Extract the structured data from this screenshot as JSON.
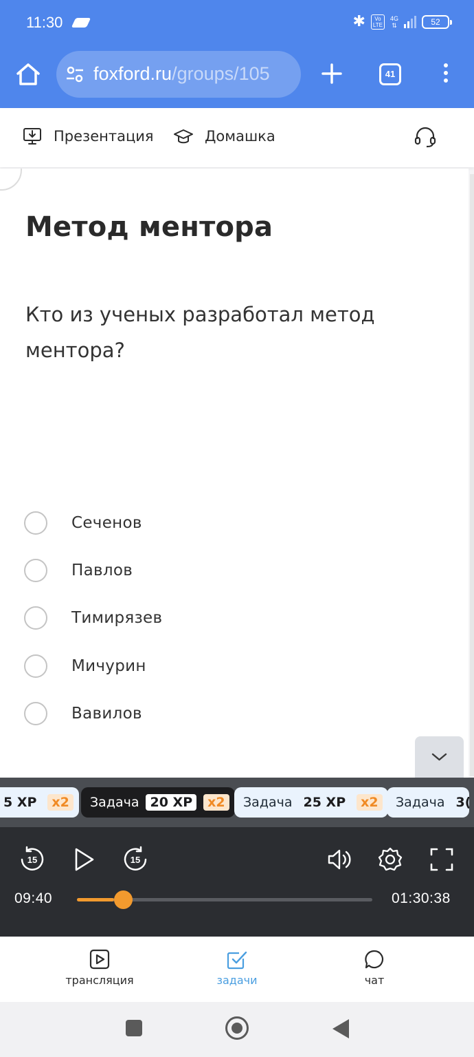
{
  "status_bar": {
    "time": "11:30",
    "volte": "Vo\nLTE",
    "network": "4G",
    "battery": "52"
  },
  "browser": {
    "url_host": "foxford.ru",
    "url_path": "/groups/105",
    "tab_count": "41"
  },
  "toolbar": {
    "presentation_label": "Презентация",
    "homework_label": "Домашка"
  },
  "task": {
    "title": "Метод ментора",
    "question": "Кто из ученых разработал метод ментора?",
    "options": [
      "Сеченов",
      "Павлов",
      "Тимирязев",
      "Мичурин",
      "Вавилов"
    ]
  },
  "task_chips": [
    {
      "label": "",
      "xp": "5 XP",
      "multiplier": "x2"
    },
    {
      "label": "Задача",
      "xp": "20 XP",
      "multiplier": "x2"
    },
    {
      "label": "Задача",
      "xp": "25 XP",
      "multiplier": "x2"
    },
    {
      "label": "Задача",
      "xp": "3(",
      "multiplier": ""
    }
  ],
  "player": {
    "current_time": "09:40",
    "total_time": "01:30:38",
    "progress": 0.107,
    "skip_back_seconds": "15",
    "skip_forward_seconds": "15"
  },
  "bottom_nav": {
    "items": [
      {
        "label": "трансляция",
        "icon": "play-square-icon",
        "active": false
      },
      {
        "label": "задачи",
        "icon": "checkbox-icon",
        "active": true
      },
      {
        "label": "чат",
        "icon": "chat-bubble-icon",
        "active": false
      }
    ]
  },
  "colors": {
    "browser_bar": "#4f86ec",
    "accent_orange": "#f29a2e",
    "active_nav": "#4a9ee0"
  }
}
